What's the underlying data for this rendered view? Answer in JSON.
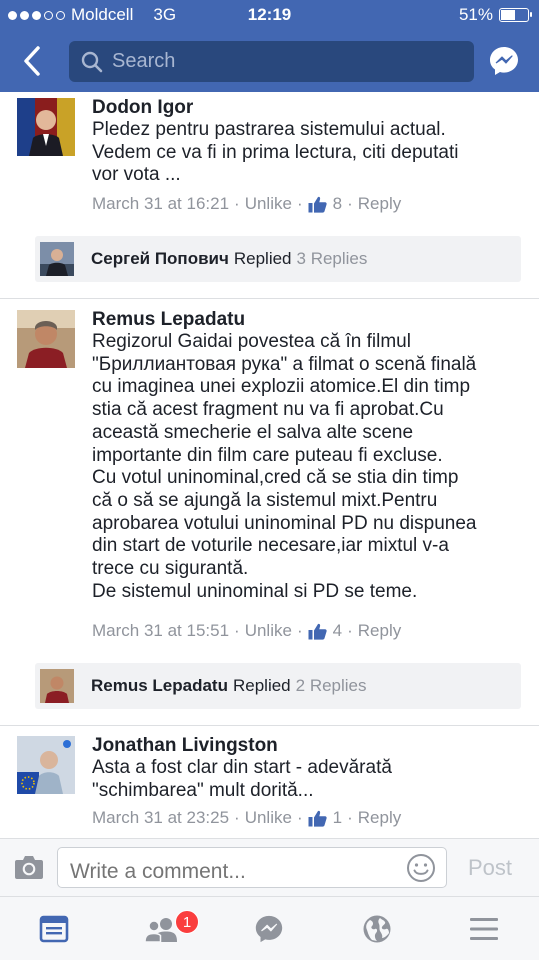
{
  "status_bar": {
    "carrier": "Moldcell",
    "network": "3G",
    "time": "12:19",
    "battery": "51%",
    "battery_level": 0.51
  },
  "header": {
    "search_placeholder": "Search"
  },
  "comments": [
    {
      "author": "Dodon Igor",
      "text_lines": [
        "Pledez pentru pastrarea sistemului actual.",
        "Vedem ce va fi in prima lectura, citi deputati",
        "vor vota ..."
      ],
      "timestamp": "March 31 at 16:21",
      "action": "Unlike",
      "likes": "8",
      "reply_label": "Reply",
      "replied_by": "Сергей Попович",
      "replied_word": "Replied",
      "replies_count": "3 Replies"
    },
    {
      "author": "Remus Lepadatu",
      "text_lines": [
        "Regizorul Gaidai povestea că în filmul",
        "\"Бриллиантовая рука\" a filmat o scenă finală",
        "cu imaginea unei explozii atomice.El din timp",
        "stia că acest fragment nu va fi aprobat.Cu",
        "această smecherie el salva alte scene",
        "importante din film care puteau fi excluse.",
        "Cu votul uninominal,cred că se stia din timp",
        "că o să se ajungă la sistemul mixt.Pentru",
        "aprobarea votului uninominal PD nu dispunea",
        "din start de voturile necesare,iar mixtul v-a",
        "trece cu sigurantă.",
        "De sistemul uninominal si PD se teme."
      ],
      "timestamp": "March 31 at 15:51",
      "action": "Unlike",
      "likes": "4",
      "reply_label": "Reply",
      "replied_by": "Remus Lepadatu",
      "replied_word": "Replied",
      "replies_count": "2 Replies"
    },
    {
      "author": "Jonathan Livingston",
      "text_lines": [
        "Asta a fost clar din start - adevărată",
        "\"schimbarea\" mult dorită..."
      ],
      "timestamp": "March 31 at 23:25",
      "action": "Unlike",
      "likes": "1",
      "reply_label": "Reply"
    }
  ],
  "composer": {
    "placeholder": "Write a comment...",
    "post_label": "Post"
  },
  "tabbar": {
    "friend_requests_badge": "1",
    "tabs": [
      "news-feed",
      "friend-requests",
      "messenger",
      "notifications",
      "menu"
    ]
  },
  "colors": {
    "brand": "#4267b2",
    "search_bg": "#29487d",
    "like_blue": "#4267b2",
    "badge_red": "#fa3e3e",
    "meta_gray": "#90949c"
  }
}
